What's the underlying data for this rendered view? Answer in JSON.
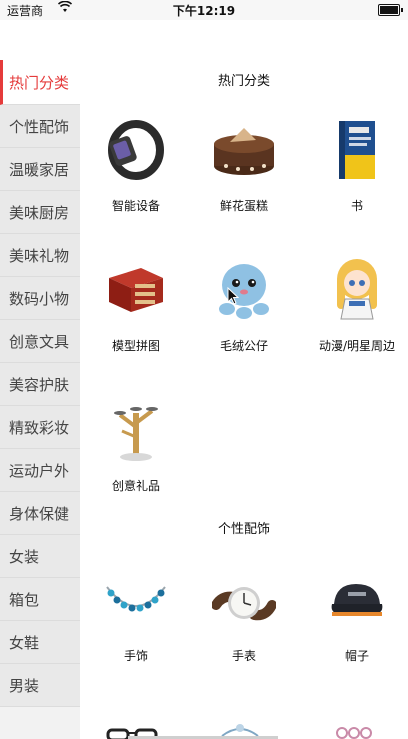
{
  "status": {
    "carrier": "运营商",
    "time": "下午12:19"
  },
  "sidebar": {
    "items": [
      {
        "label": "热门分类",
        "active": true
      },
      {
        "label": "个性配饰"
      },
      {
        "label": "温暖家居"
      },
      {
        "label": "美味厨房"
      },
      {
        "label": "美味礼物"
      },
      {
        "label": "数码小物"
      },
      {
        "label": "创意文具"
      },
      {
        "label": "美容护肤"
      },
      {
        "label": "精致彩妆"
      },
      {
        "label": "运动户外"
      },
      {
        "label": "身体保健"
      },
      {
        "label": "女装"
      },
      {
        "label": "箱包"
      },
      {
        "label": "女鞋"
      },
      {
        "label": "男装"
      }
    ]
  },
  "sections": [
    {
      "title": "热门分类",
      "items": [
        {
          "label": "智能设备",
          "icon": "smart-band-icon"
        },
        {
          "label": "鲜花蛋糕",
          "icon": "cake-icon"
        },
        {
          "label": "书",
          "icon": "book-icon"
        },
        {
          "label": "模型拼图",
          "icon": "puzzle-model-icon"
        },
        {
          "label": "毛绒公仔",
          "icon": "plush-toy-icon"
        },
        {
          "label": "动漫/明星周边",
          "icon": "anime-figure-icon"
        },
        {
          "label": "创意礼品",
          "icon": "creative-gift-icon"
        }
      ]
    },
    {
      "title": "个性配饰",
      "items": [
        {
          "label": "手饰",
          "icon": "bracelet-icon"
        },
        {
          "label": "手表",
          "icon": "watch-icon"
        },
        {
          "label": "帽子",
          "icon": "cap-icon"
        }
      ]
    }
  ]
}
